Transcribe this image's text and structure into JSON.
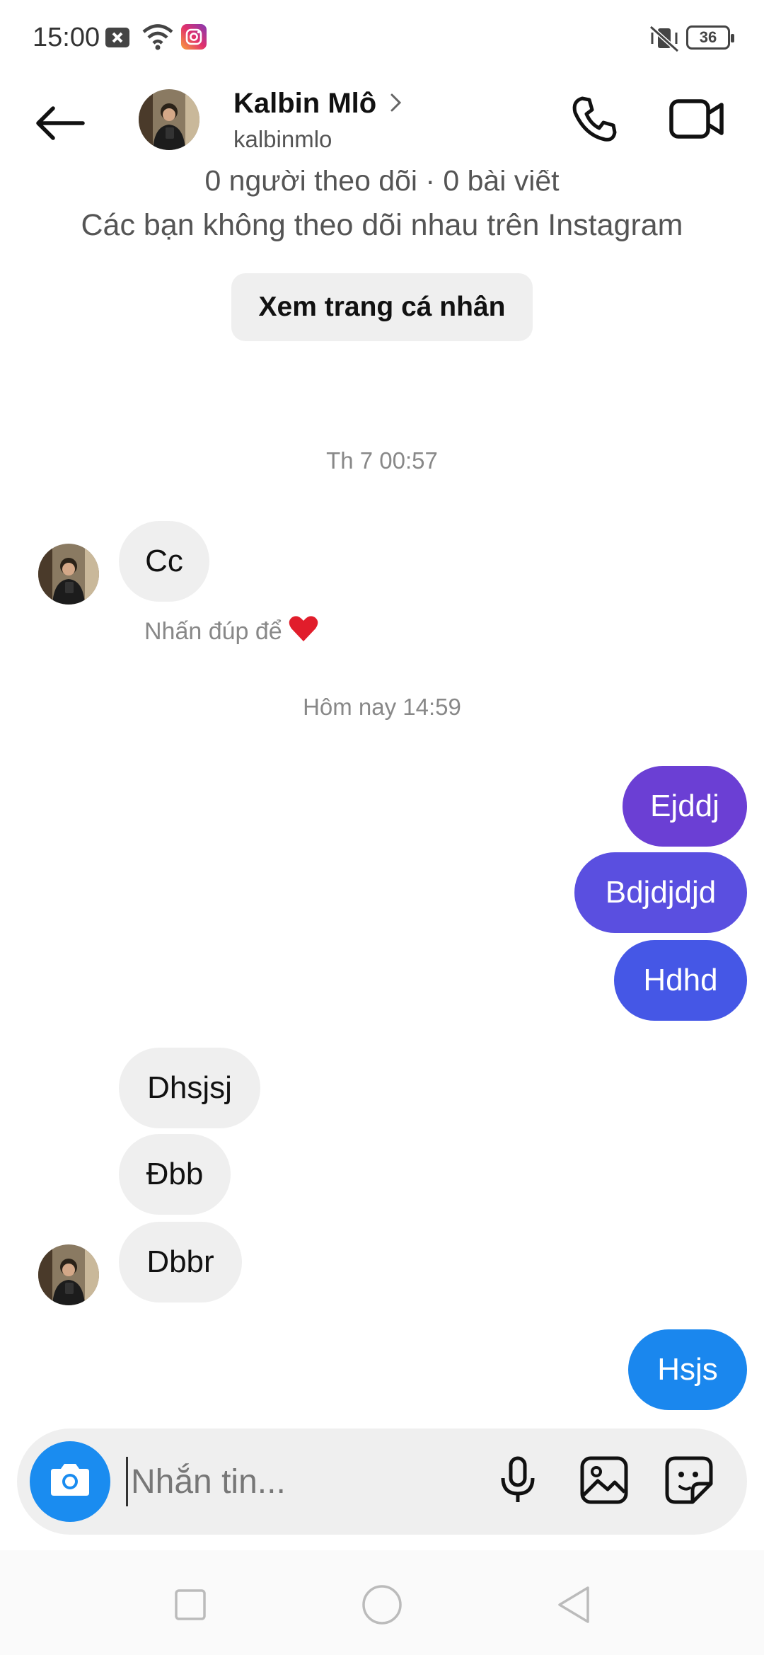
{
  "status_bar": {
    "time": "15:00",
    "battery": "36",
    "icons": [
      "notification-close-icon",
      "wifi-icon",
      "instagram-icon",
      "vibrate-off-icon",
      "battery-icon"
    ]
  },
  "header": {
    "name": "Kalbin Mlô",
    "username": "kalbinmlo",
    "icons": [
      "back-arrow-icon",
      "chevron-right-icon",
      "phone-icon",
      "video-camera-icon"
    ]
  },
  "profile": {
    "stats": "0 người theo dõi · 0 bài viết",
    "follow_status": "Các bạn không theo dõi nhau trên Instagram",
    "view_profile_label": "Xem trang cá nhân"
  },
  "chat": {
    "timestamp_1": "Th 7 00:57",
    "msg_cc": "Cc",
    "double_tap": "Nhấn đúp để",
    "timestamp_2": "Hôm nay 14:59",
    "out_1": "Ejddj",
    "out_2": "Bdjdjdjd",
    "out_3": "Hdhd",
    "in_1": "Dhsjsj",
    "in_2": "Đbb",
    "in_3": "Dbbr",
    "out_4": "Hsjs"
  },
  "colors": {
    "bubble_gradient": [
      "#6b3fd4",
      "#5a4fe0",
      "#4557e6"
    ],
    "bubble_blue": "#1a87ee",
    "camera_button": "#1a8cf0",
    "heart": "#e11d2b"
  },
  "composer": {
    "placeholder": "Nhắn tin...",
    "icons": [
      "camera-icon",
      "microphone-icon",
      "gallery-icon",
      "sticker-icon"
    ]
  },
  "nav_bar": {
    "icons": [
      "recents-square-icon",
      "home-circle-icon",
      "back-triangle-icon"
    ]
  }
}
